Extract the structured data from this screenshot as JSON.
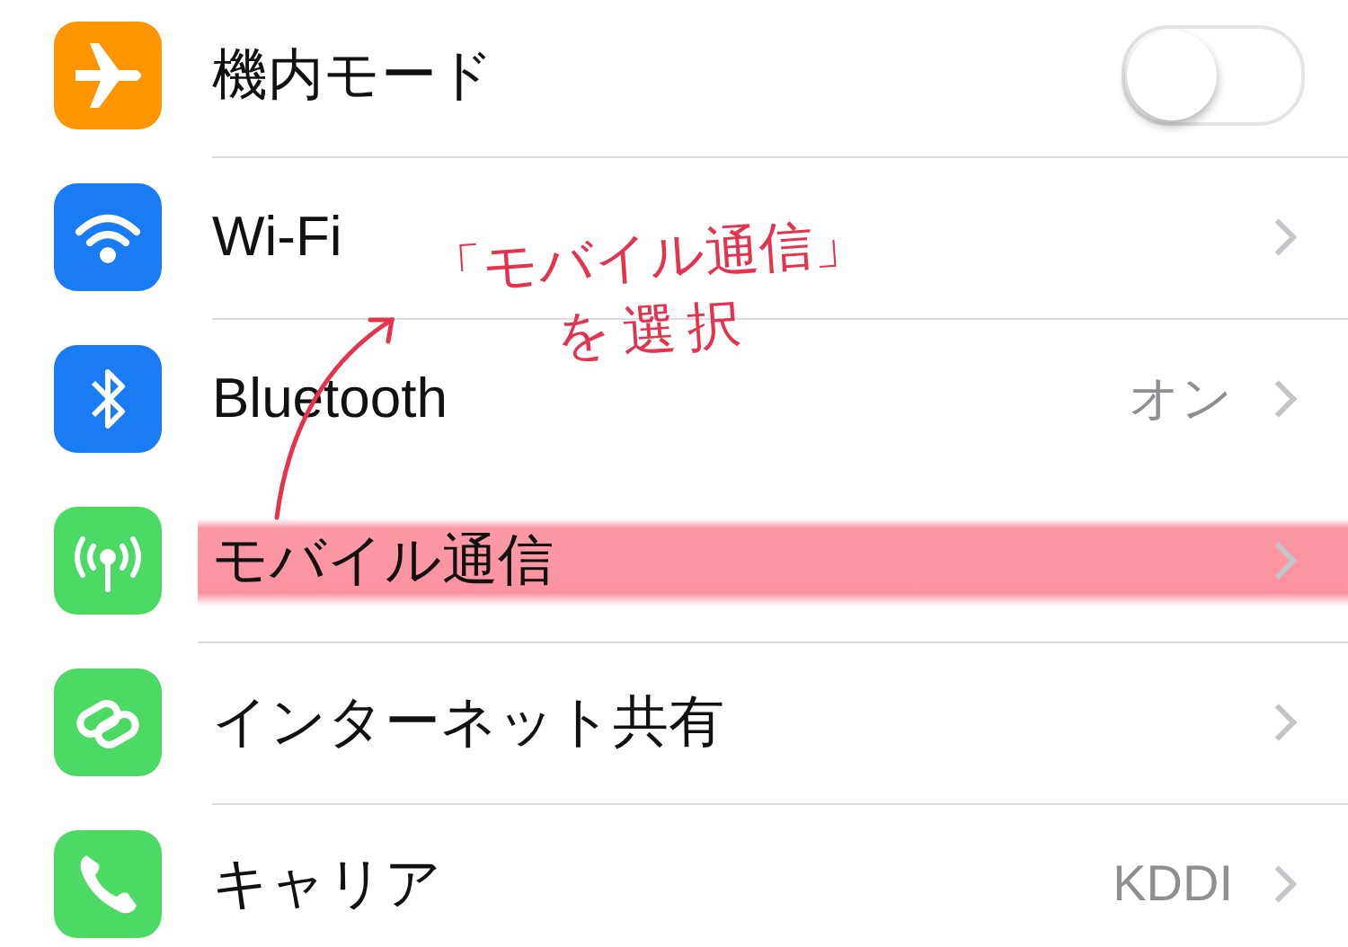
{
  "rows": [
    {
      "kind": "toggle",
      "label": "機内モード",
      "color": "#ff9500",
      "on": false,
      "highlighted": false
    },
    {
      "kind": "link",
      "label": "Wi-Fi",
      "color": "#1a7cf5",
      "highlighted": false
    },
    {
      "kind": "link",
      "label": "Bluetooth",
      "color": "#1a7cf5",
      "value": "オン",
      "highlighted": false
    },
    {
      "kind": "link",
      "label": "モバイル通信",
      "color": "#4cd964",
      "highlighted": true
    },
    {
      "kind": "link",
      "label": "インターネット共有",
      "color": "#4cd964",
      "highlighted": false
    },
    {
      "kind": "link",
      "label": "キャリア",
      "color": "#4cd964",
      "value": "KDDI",
      "highlighted": false
    }
  ],
  "annotation": {
    "lines": [
      "「モバイル通信」",
      "を選択"
    ]
  }
}
